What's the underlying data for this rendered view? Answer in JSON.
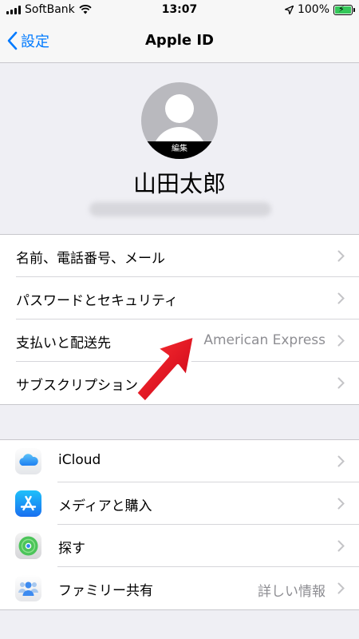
{
  "status_bar": {
    "carrier": "SoftBank",
    "time": "13:07",
    "battery": "100%",
    "icons": [
      "signal-icon",
      "wifi-icon",
      "location-icon",
      "battery-charging-icon"
    ]
  },
  "nav": {
    "back_label": "設定",
    "title": "Apple ID"
  },
  "profile": {
    "edit_label": "編集",
    "name": "山田太郎"
  },
  "account_rows": [
    {
      "label": "名前、電話番号、メール",
      "value": ""
    },
    {
      "label": "パスワードとセキュリティ",
      "value": ""
    },
    {
      "label": "支払いと配送先",
      "value": "American Express"
    },
    {
      "label": "サブスクリプション",
      "value": ""
    }
  ],
  "service_rows": [
    {
      "label": "iCloud",
      "value": "",
      "icon": "icloud-icon"
    },
    {
      "label": "メディアと購入",
      "value": "",
      "icon": "app-store-icon"
    },
    {
      "label": "探す",
      "value": "",
      "icon": "find-my-icon"
    },
    {
      "label": "ファミリー共有",
      "value": "詳しい情報",
      "icon": "family-sharing-icon"
    }
  ],
  "colors": {
    "accent": "#007aff",
    "background": "#efeff4",
    "secondary_text": "#8e8e93",
    "annotation_arrow": "#e8001c"
  }
}
